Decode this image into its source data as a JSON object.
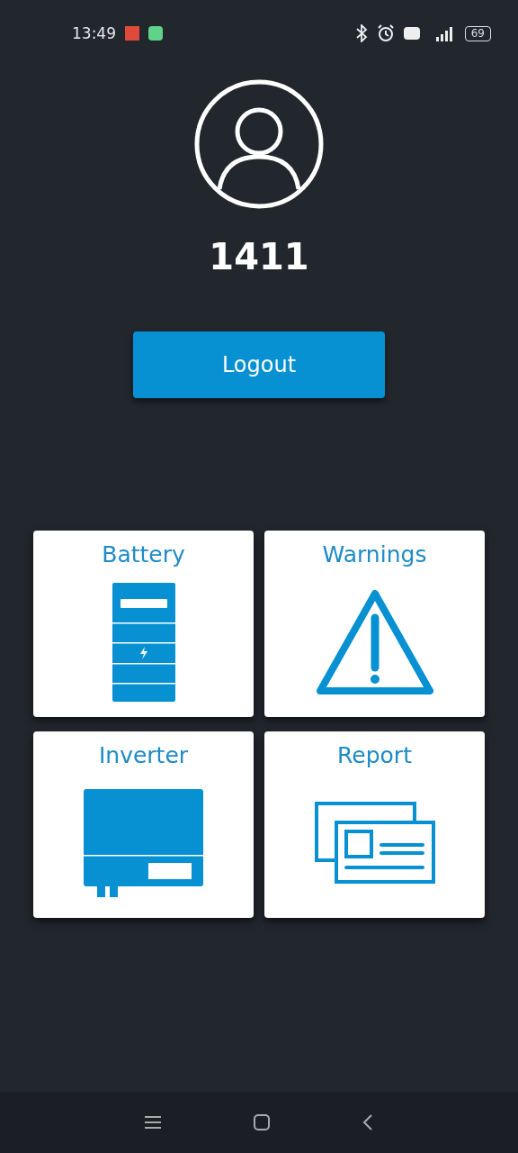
{
  "status_bar": {
    "time": "13:49",
    "battery": "69"
  },
  "user": {
    "name": "1411"
  },
  "logout_button": {
    "label": "Logout"
  },
  "tiles": [
    {
      "label": "Battery",
      "kind": "battery"
    },
    {
      "label": "Warnings",
      "kind": "warning"
    },
    {
      "label": "Inverter",
      "kind": "inverter"
    },
    {
      "label": "Report",
      "kind": "report"
    }
  ]
}
